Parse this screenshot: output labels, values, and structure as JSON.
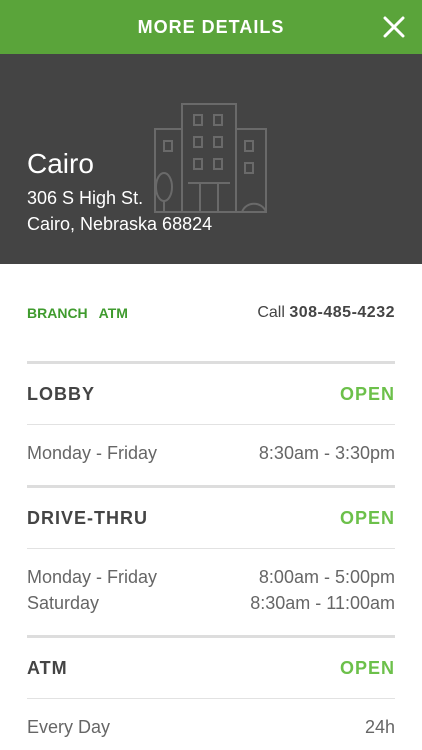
{
  "header": {
    "title": "MORE DETAILS",
    "close_icon": "close-icon"
  },
  "hero": {
    "name": "Cairo",
    "address_line1": "306 S High St.",
    "address_line2": "Cairo, Nebraska 68824",
    "illustration_icon": "building-icon"
  },
  "details": {
    "tags": [
      "BRANCH",
      "ATM"
    ],
    "call_label": "Call",
    "phone": "308-485-4232"
  },
  "sections": [
    {
      "title": "LOBBY",
      "status": "OPEN",
      "hours": [
        {
          "days": "Monday - Friday",
          "time": "8:30am - 3:30pm"
        }
      ]
    },
    {
      "title": "DRIVE-THRU",
      "status": "OPEN",
      "hours": [
        {
          "days": "Monday - Friday",
          "time": "8:00am - 5:00pm"
        },
        {
          "days": "Saturday",
          "time": "8:30am - 11:00am"
        }
      ]
    },
    {
      "title": "ATM",
      "status": "OPEN",
      "hours": [
        {
          "days": "Every Day",
          "time": "24h"
        }
      ]
    }
  ],
  "colors": {
    "header_bg": "#5aa43a",
    "hero_bg": "#444444",
    "open_status": "#6cc04a",
    "tag_green": "#3f9b2e"
  }
}
